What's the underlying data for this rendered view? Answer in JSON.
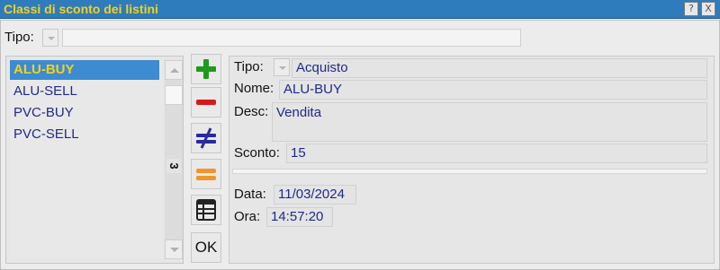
{
  "window": {
    "title": "Classi di sconto dei listini",
    "help_label": "?",
    "close_label": "X"
  },
  "filter": {
    "tipo_label": "Tipo:",
    "tipo_value": ""
  },
  "list": {
    "items": [
      {
        "label": "ALU-BUY",
        "selected": true
      },
      {
        "label": "ALU-SELL",
        "selected": false
      },
      {
        "label": "PVC-BUY",
        "selected": false
      },
      {
        "label": "PVC-SELL",
        "selected": false
      }
    ],
    "row_count": "3"
  },
  "toolbar": {
    "add_icon": "plus-icon",
    "delete_icon": "minus-icon",
    "not_equal_icon": "not-equal-icon",
    "equal_icon": "equal-icon",
    "table_icon": "table-icon",
    "ok_label": "OK",
    "colors": {
      "add": "#1f9a1f",
      "delete": "#d61a1a",
      "not_equal": "#2a2aa0",
      "equal": "#f0962a",
      "table": "#222222"
    }
  },
  "detail": {
    "tipo_label": "Tipo:",
    "tipo_value": "Acquisto",
    "nome_label": "Nome:",
    "nome_value": "ALU-BUY",
    "desc_label": "Desc:",
    "desc_value": "Vendita",
    "sconto_label": "Sconto:",
    "sconto_value": "15",
    "data_label": "Data:",
    "data_value": "11/03/2024",
    "ora_label": "Ora:",
    "ora_value": "14:57:20"
  },
  "colors": {
    "titlebar": "#2f7cbd",
    "title_text": "#f5d21a",
    "selection": "#3d8bd0",
    "value_text": "#1f2a8a"
  }
}
